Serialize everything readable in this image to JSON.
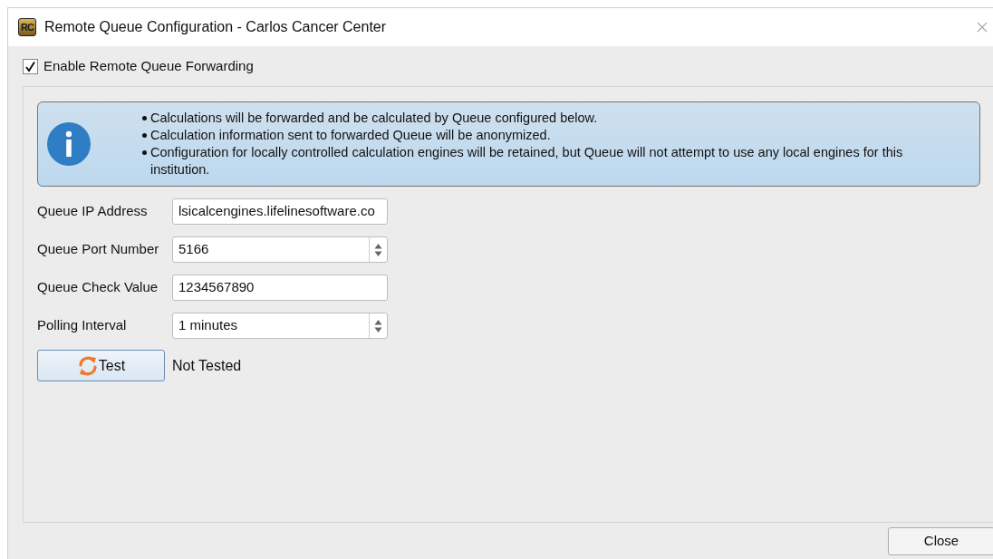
{
  "window": {
    "logo": "RC",
    "title": "Remote Queue Configuration - Carlos Cancer Center"
  },
  "enable_forwarding": {
    "label": "Enable Remote Queue Forwarding",
    "checked": true
  },
  "info": {
    "bullets": [
      "Calculations will be forwarded and be calculated by Queue configured below.",
      "Calculation information sent to forwarded Queue will be anonymized.",
      "Configuration for locally controlled calculation engines will be retained, but Queue will not attempt to use any local engines for this institution."
    ]
  },
  "fields": [
    {
      "label": "Queue IP Address",
      "kind": "text",
      "value": "lsicalcengines.lifelinesoftware.co"
    },
    {
      "label": "Queue Port Number",
      "kind": "spinbox",
      "value": "5166"
    },
    {
      "label": "Queue Check Value",
      "kind": "text",
      "value": "1234567890"
    },
    {
      "label": "Polling Interval",
      "kind": "spinbox",
      "value": "1 minutes"
    }
  ],
  "test": {
    "button": "Test",
    "status": "Not Tested"
  },
  "buttons": [
    "Close"
  ]
}
